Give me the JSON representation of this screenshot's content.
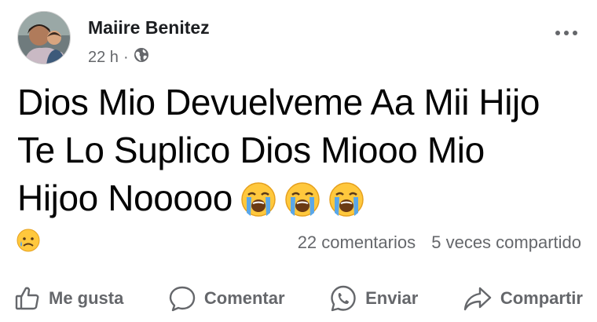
{
  "post": {
    "author": "Maiire Benitez",
    "time": "22 h",
    "separator": "·",
    "privacy_icon": "globe-icon",
    "more_icon": "more-dots-icon",
    "text": "Dios Mio Devuelveme Aa Mii Hijo Te Lo Suplico Dios Miooo Mio Hijoo Nooooo",
    "text_emojis": [
      "loudly-crying-face",
      "loudly-crying-face",
      "loudly-crying-face"
    ]
  },
  "stats": {
    "reaction_icon": "sad-face-reaction",
    "comments": "22 comentarios",
    "shares": "5 veces compartido"
  },
  "actions": {
    "like_label": "Me gusta",
    "comment_label": "Comentar",
    "send_label": "Enviar",
    "share_label": "Compartir"
  },
  "colors": {
    "text": "#050505",
    "secondary": "#65676b",
    "emoji_yellow": "#ffc83d",
    "tear_blue": "#5aa7e8"
  }
}
